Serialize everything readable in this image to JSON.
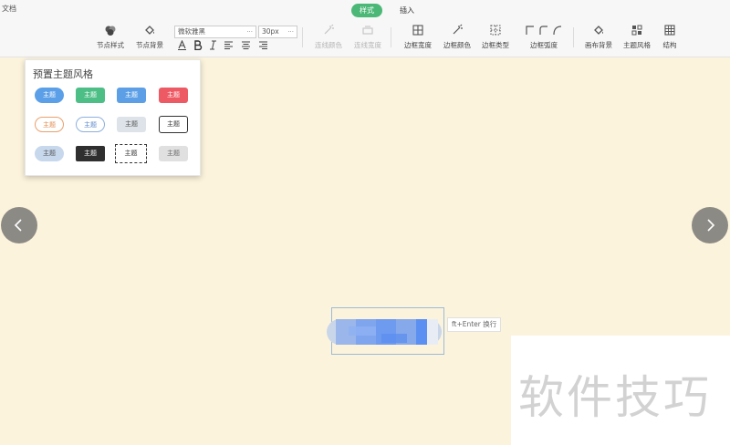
{
  "app": {
    "doc_label": "文档"
  },
  "tabs": [
    {
      "label": "样式",
      "active": true
    },
    {
      "label": "插入",
      "active": false
    }
  ],
  "toolbar": {
    "node_style": "节点样式",
    "node_bg": "节点背景",
    "font_family": "微软雅黑",
    "font_size": "30px",
    "line_color": "连线颜色",
    "line_width": "连线宽度",
    "border_width": "边框宽度",
    "border_color": "边框颜色",
    "border_type": "边框类型",
    "border_radius": "边框弧度",
    "canvas_bg": "画布背景",
    "theme_style": "主题风格",
    "structure": "结构",
    "dropdown_glyph": "···"
  },
  "theme_panel": {
    "title": "预置主题风格",
    "item_label": "主题"
  },
  "canvas": {
    "hint": "ft+Enter 换行"
  },
  "watermark": "软件技巧",
  "colors": {
    "canvas_bg": "#fcf3dc",
    "accent": "#4cb877"
  }
}
